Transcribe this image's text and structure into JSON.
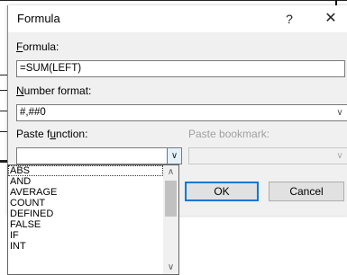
{
  "dialog": {
    "title": "Formula",
    "help_glyph": "?",
    "close_glyph": "✕",
    "formula": {
      "label_u": "F",
      "label_rest": "ormula:",
      "value": "=SUM(LEFT)"
    },
    "number_format": {
      "label_u": "N",
      "label_rest": "umber format:",
      "value": "#,##0"
    },
    "paste_function": {
      "label_pre": "Paste f",
      "label_u": "u",
      "label_rest": "nction:",
      "value": ""
    },
    "paste_bookmark": {
      "label": "Paste bookmark:",
      "value": ""
    },
    "ok_label": "OK",
    "cancel_label": "Cancel"
  },
  "function_list": {
    "items": [
      "ABS",
      "AND",
      "AVERAGE",
      "COUNT",
      "DEFINED",
      "FALSE",
      "IF",
      "INT"
    ],
    "focused_index": 0
  },
  "icons": {
    "dropdown_arrow": "chevron-down-icon",
    "scroll_up": "chevron-up-icon",
    "scroll_down": "chevron-down-icon"
  },
  "colors": {
    "dialog_bg": "#f0f0f0",
    "default_button_border": "#0078d7",
    "active_arrow_bg": "#e5f1fb"
  }
}
